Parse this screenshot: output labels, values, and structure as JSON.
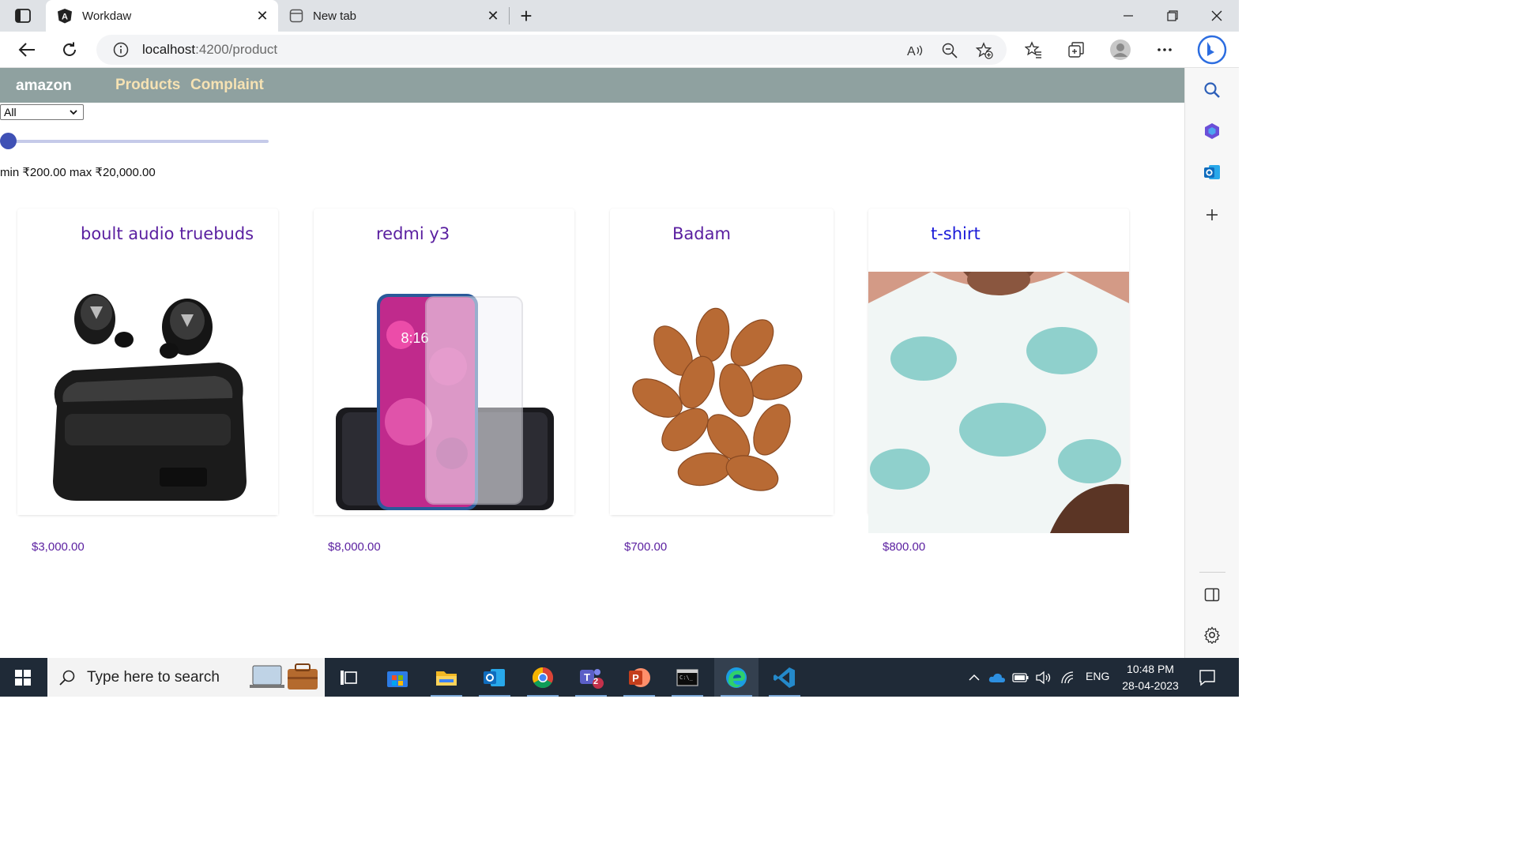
{
  "browser": {
    "tabs": [
      {
        "title": "Workdaw",
        "active": true,
        "icon": "angular-icon"
      },
      {
        "title": "New tab",
        "active": false,
        "icon": "new-tab-icon"
      }
    ],
    "address": {
      "host": "localhost",
      "path": ":4200/product"
    }
  },
  "app": {
    "brand": "amazon",
    "nav": [
      "Products",
      "Complaint"
    ],
    "filter": {
      "selected": "All"
    },
    "price": {
      "min_label": "min ₹200.00 max ₹20,000.00",
      "slider_fraction": 0.0
    },
    "products": [
      {
        "name": "boult audio truebuds",
        "price": "$3,000.00",
        "image": "earbuds-image"
      },
      {
        "name": "redmi y3",
        "price": "$8,000.00",
        "image": "phone-image"
      },
      {
        "name": "Badam",
        "price": "$700.00",
        "image": "almonds-image"
      },
      {
        "name": "t-shirt",
        "price": "$800.00",
        "image": "tshirt-image"
      }
    ]
  },
  "taskbar": {
    "search_placeholder": "Type here to search",
    "lang": "ENG",
    "time": "10:48 PM",
    "date": "28-04-2023",
    "teams_badge": "2"
  },
  "colors": {
    "navbar": "#8fa1a0",
    "nav_link": "#f6e2b3",
    "product_text": "#5a1fa0",
    "slider": "#3f51b5",
    "taskbar": "#1f2a37"
  }
}
